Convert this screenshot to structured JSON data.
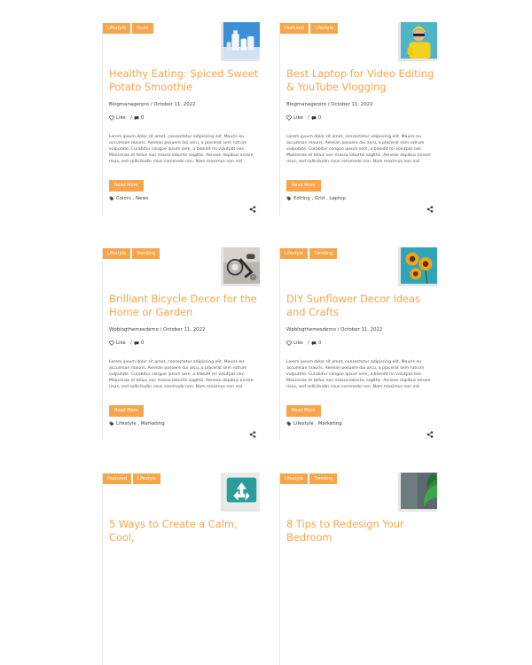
{
  "posts": [
    {
      "tags": [
        "Lifestyle",
        "News"
      ],
      "title": "Healthy Eating: Spiced Sweet Potato Smoothie",
      "author": "Blogmanagerpro",
      "date": "October 11, 2022",
      "like_label": "Like",
      "comments": "0",
      "excerpt": "Lorem ipsum dolor sit amet, consectetur adipiscing elit. Mauris eu accumsan mauris. Aenean posuere dui arcu, a placerat sem rutrum vulputate. Curabitur congue ipsum sem, a blandit mi volutpat nec. Maecenas et tellus non massa lobortis sagittis. Aenean dapibus ornare risus, sed sollicitudin risus commodo non. Nam maximus non nisl",
      "button": "Read More",
      "categories": "Colors , News",
      "image": "bottles-on-blue"
    },
    {
      "tags": [
        "Featured",
        "Lifestyle"
      ],
      "title": "Best Laptop for Video Editing & YouTube Vlogging",
      "author": "Blogmanagerpro",
      "date": "October 11, 2022",
      "like_label": "Like",
      "comments": "0",
      "excerpt": "Lorem ipsum dolor sit amet, consectetur adipiscing elit. Mauris eu accumsan mauris. Aenean posuere dui arcu, a placerat sem rutrum vulputate. Curabitur congue ipsum sem, a blandit mi volutpat nec. Maecenas et tellus non massa lobortis sagittis. Aenean dapibus ornare risus, sed sollicitudin risus commodo non. Nam maximus non nisl",
      "button": "Read More",
      "categories": "Editing , Grid , Laptop",
      "image": "person-yellow-on-teal"
    },
    {
      "tags": [
        "Lifestyle",
        "Trending"
      ],
      "title": "Brilliant Bicycle Decor for the Home or Garden",
      "author": "Wpblogthemesdemo",
      "date": "October 11, 2022",
      "like_label": "Like",
      "comments": "0",
      "excerpt": "Lorem ipsum dolor sit amet, consectetur adipiscing elit. Mauris eu accumsan mauris. Aenean posuere dui arcu, a placerat sem rutrum vulputate. Curabitur congue ipsum sem, a blandit mi volutpat nec. Maecenas et tellus non massa lobortis sagittis. Aenean dapibus ornare risus, sed sollicitudin risus commodo non. Nam maximus non nisl",
      "button": "Read More",
      "categories": "Lifestyle , Marketing",
      "image": "bicycle-gray"
    },
    {
      "tags": [
        "Lifestyle",
        "Trending"
      ],
      "title": "DIY Sunflower Decor Ideas and Crafts",
      "author": "Wpblogthemesdemo",
      "date": "October 11, 2022",
      "like_label": "Like",
      "comments": "0",
      "excerpt": "Lorem ipsum dolor sit amet, consectetur adipiscing elit. Mauris eu accumsan mauris. Aenean posuere dui arcu, a placerat sem rutrum vulputate. Curabitur congue ipsum sem, a blandit mi volutpat nec. Maecenas et tellus non massa lobortis sagittis. Aenean dapibus ornare risus, sed sollicitudin risus commodo non. Nam maximus non nisl",
      "button": "Read More",
      "categories": "Lifestyle , Marketing",
      "image": "sunflowers-on-teal"
    },
    {
      "tags": [
        "Featured",
        "Lifestyle"
      ],
      "title": "5 Ways to Create a Calm, Cool,",
      "image": "recycle-teal"
    },
    {
      "tags": [
        "Lifestyle",
        "Trending"
      ],
      "title": "8 Tips to Redesign Your Bedroom",
      "image": "plant-on-gray"
    }
  ],
  "colors": {
    "accent": "#f7a54a",
    "border": "#e6e6e6"
  }
}
